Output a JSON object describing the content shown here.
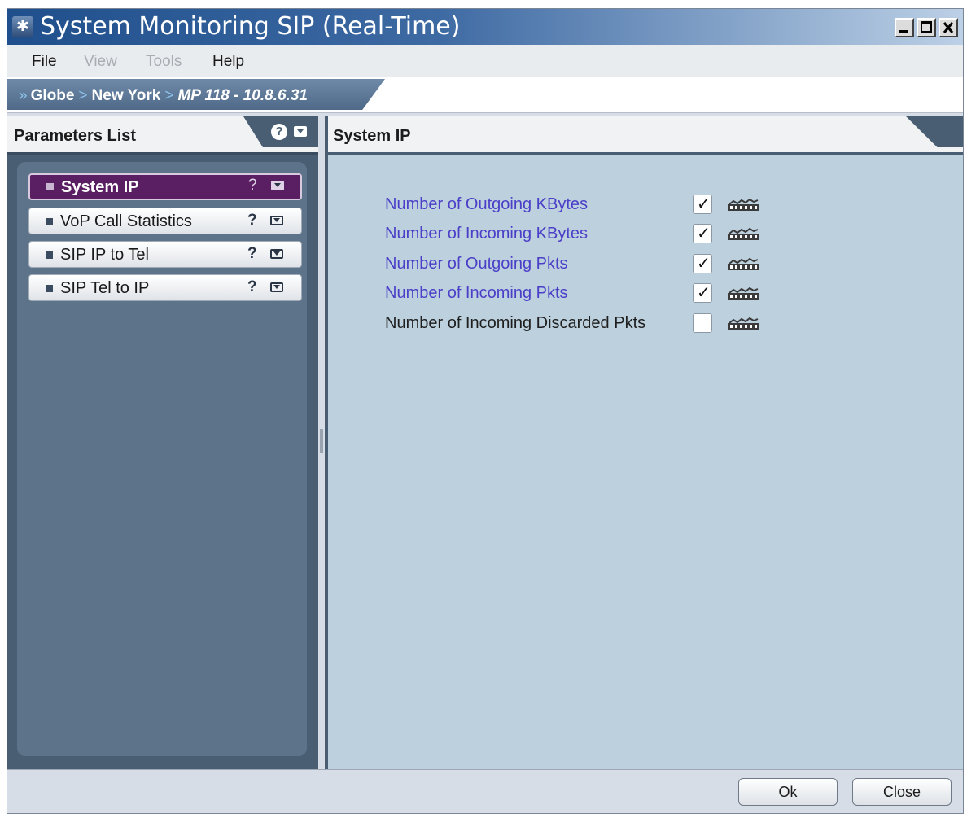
{
  "window": {
    "title": "System Monitoring SIP (Real-Time)",
    "controls": {
      "minimize": "_",
      "maximize": "□",
      "close": "×"
    }
  },
  "menubar": {
    "items": [
      {
        "label": "File",
        "enabled": true
      },
      {
        "label": "View",
        "enabled": false
      },
      {
        "label": "Tools",
        "enabled": false
      },
      {
        "label": "Help",
        "enabled": true
      }
    ]
  },
  "breadcrumb": {
    "lead": "»",
    "separator": ">",
    "items": [
      "Globe",
      "New York",
      "MP 118 - 10.8.6.31"
    ]
  },
  "parameters_list": {
    "title": "Parameters List",
    "help_glyph": "?",
    "items": [
      {
        "label": "System IP",
        "active": true,
        "help": "?"
      },
      {
        "label": "VoP Call Statistics",
        "active": false,
        "help": "?"
      },
      {
        "label": "SIP IP to Tel",
        "active": false,
        "help": "?"
      },
      {
        "label": "SIP Tel to IP",
        "active": false,
        "help": "?"
      }
    ]
  },
  "system_ip": {
    "title": "System IP",
    "check_glyph": "✓",
    "parameters": [
      {
        "label": "Number of Outgoing KBytes",
        "checked": true
      },
      {
        "label": "Number of Incoming KBytes",
        "checked": true
      },
      {
        "label": "Number of Outgoing Pkts",
        "checked": true
      },
      {
        "label": "Number of Incoming Pkts",
        "checked": true
      },
      {
        "label": "Number of Incoming Discarded Pkts",
        "checked": false
      }
    ]
  },
  "buttons": {
    "ok": "Ok",
    "close": "Close"
  },
  "colors": {
    "title_bar": "#1f4f8c",
    "active_item": "#5a1e63",
    "checked_label": "#4b3fc8",
    "panel_dark": "#4a5e73",
    "content_bg": "#bdd0de"
  },
  "icons": {
    "app": "gear-icon",
    "param_chart": "graph-icon",
    "item_menu": "dropdown-menu-icon",
    "item_help": "help-icon"
  }
}
